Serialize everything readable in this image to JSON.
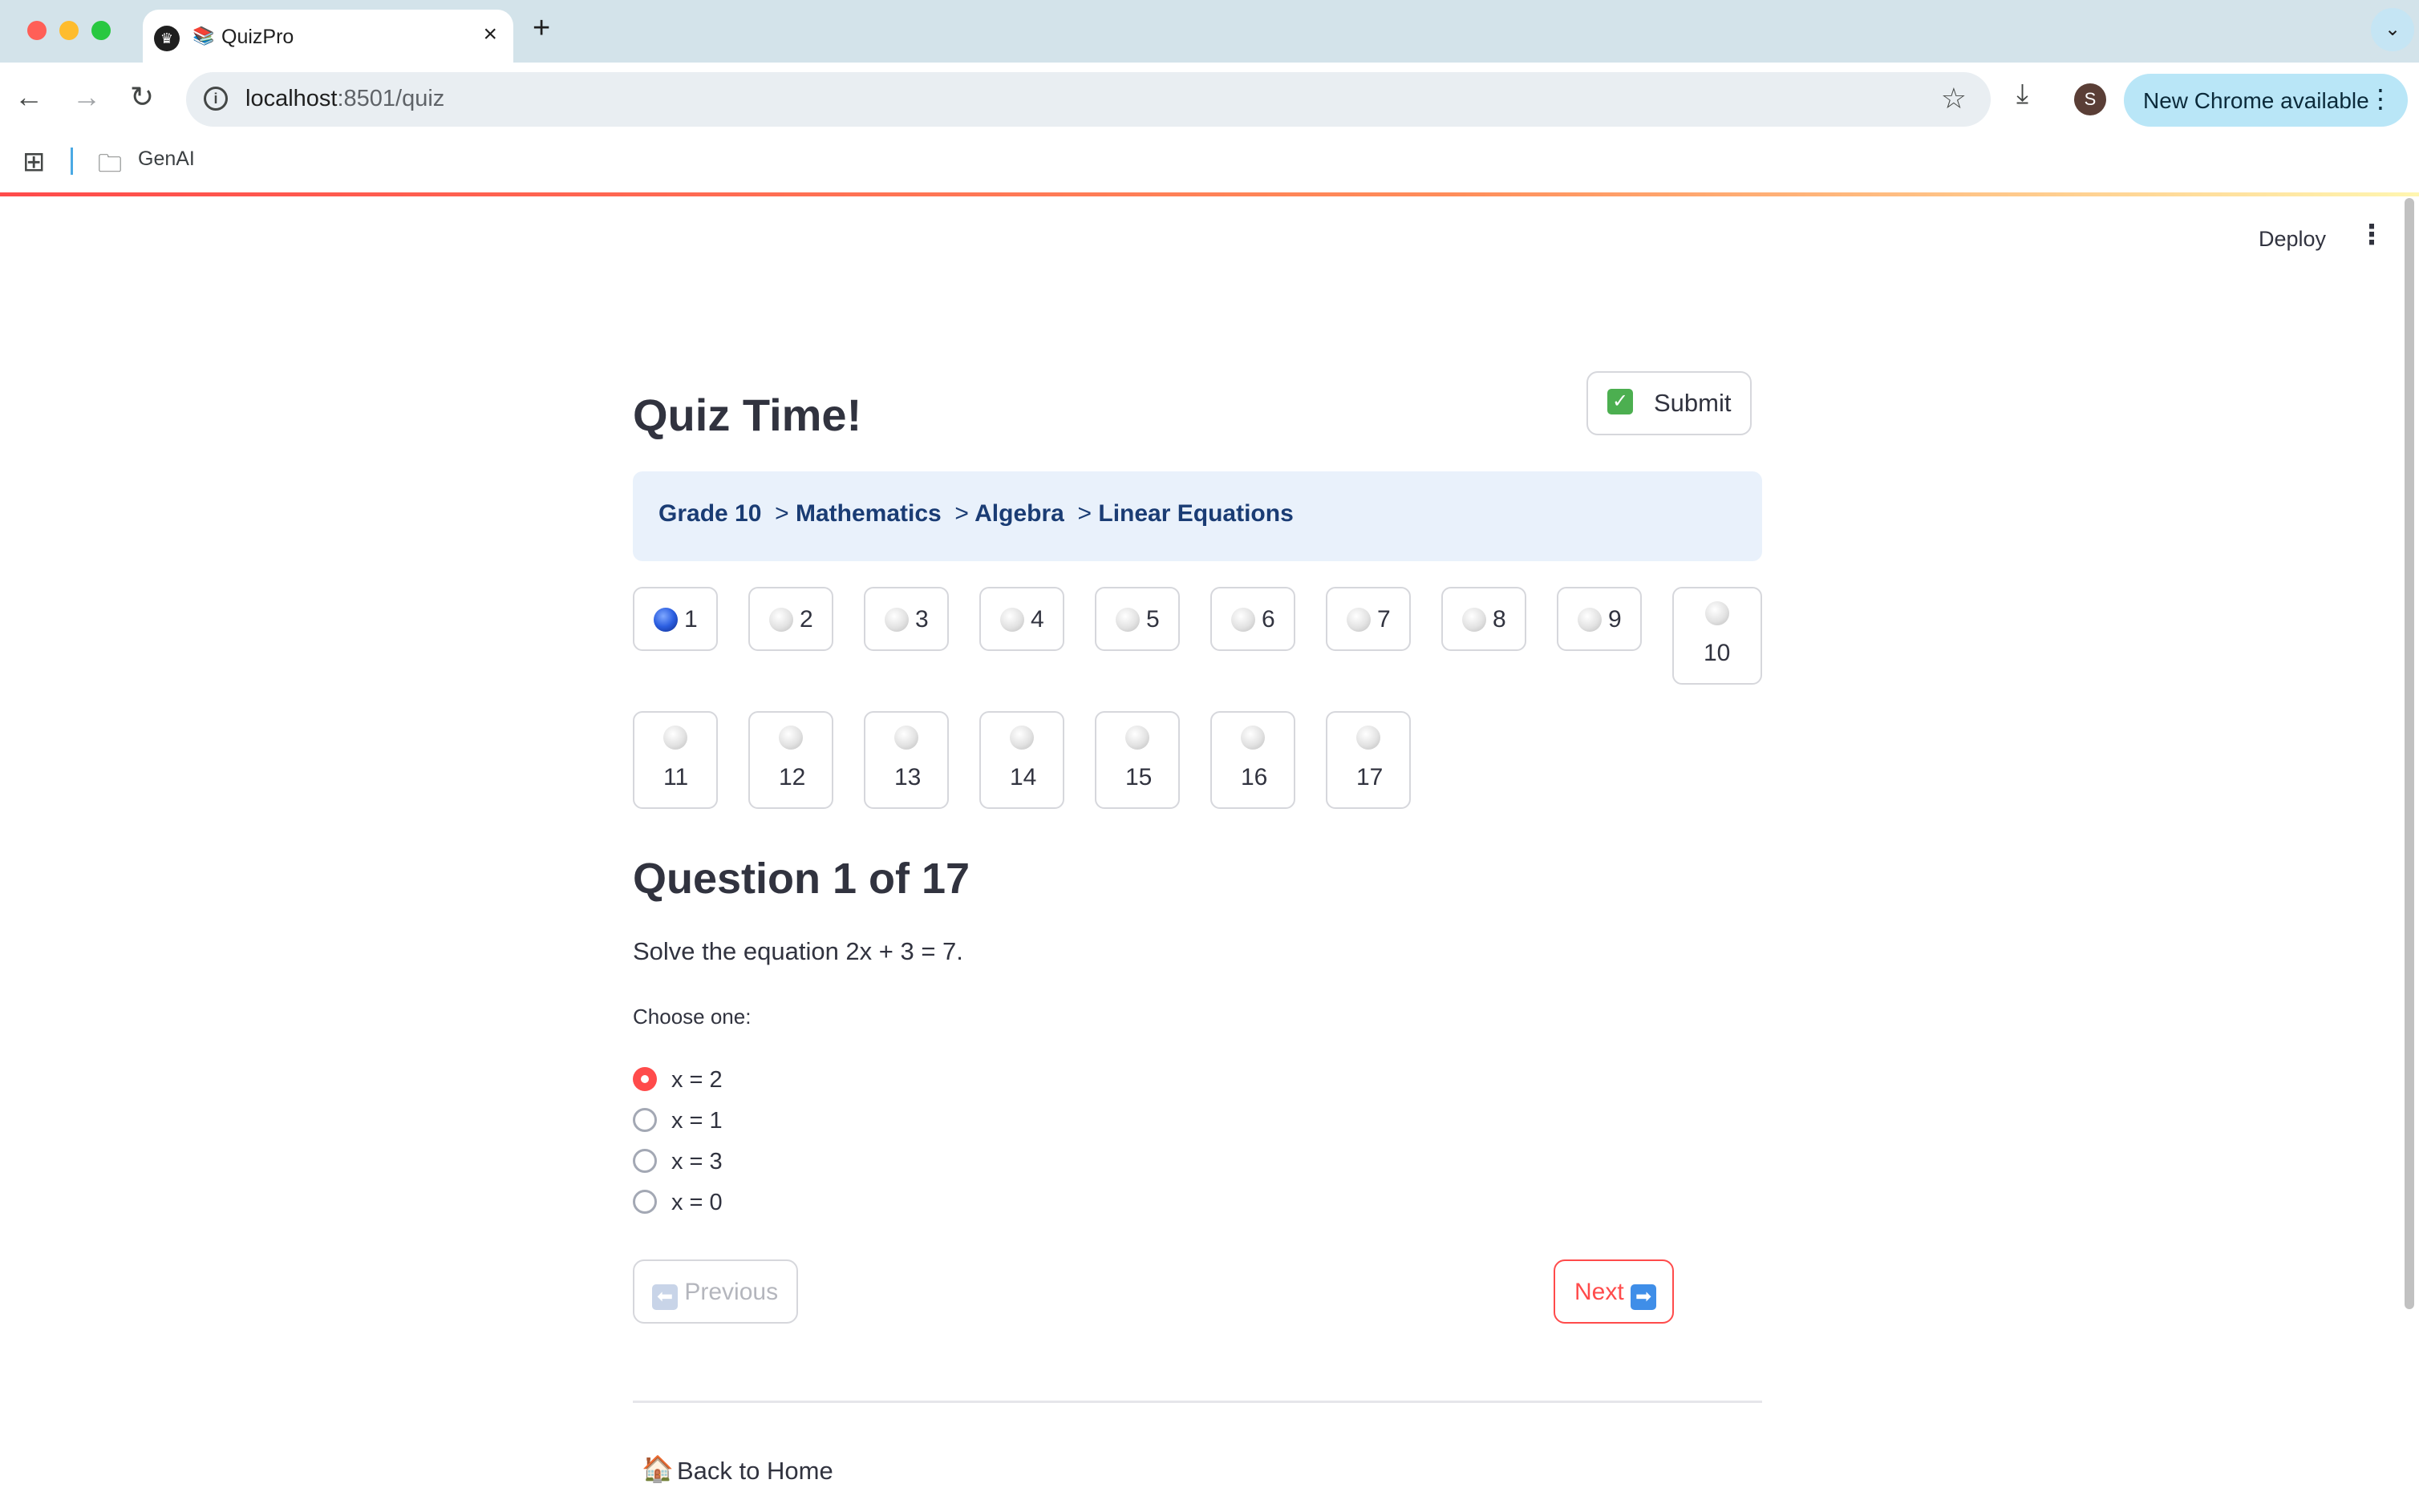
{
  "browser": {
    "tab_title": "QuizPro",
    "tab_emoji": "📚",
    "url_host": "localhost",
    "url_rest": ":8501/quiz",
    "update_label": "New Chrome available",
    "profile_initial": "S",
    "bookmark_folder": "GenAI"
  },
  "app_header": {
    "deploy_label": "Deploy"
  },
  "quiz": {
    "title": "Quiz Time!",
    "submit_label": "Submit",
    "breadcrumb": {
      "grade": "Grade 10",
      "subject": "Mathematics",
      "topic": "Algebra",
      "subtopic": "Linear Equations",
      "sep": ">"
    },
    "navigator": [
      {
        "number": "1",
        "active": true
      },
      {
        "number": "2"
      },
      {
        "number": "3"
      },
      {
        "number": "4"
      },
      {
        "number": "5"
      },
      {
        "number": "6"
      },
      {
        "number": "7"
      },
      {
        "number": "8"
      },
      {
        "number": "9"
      },
      {
        "number": "10"
      },
      {
        "number": "11"
      },
      {
        "number": "12"
      },
      {
        "number": "13"
      },
      {
        "number": "14"
      },
      {
        "number": "15"
      },
      {
        "number": "16"
      },
      {
        "number": "17"
      }
    ],
    "question_heading": "Question 1 of 17",
    "question_text": "Solve the equation 2x + 3 = 7.",
    "choose_label": "Choose one:",
    "options": [
      "x = 2",
      "x = 1",
      "x = 3",
      "x = 0"
    ],
    "selected_option": "x = 2",
    "previous_label": "Previous",
    "next_label": "Next",
    "back_home_label": "Back to Home"
  },
  "colors": {
    "accent": "#ff4b4b",
    "breadcrumb_bg": "#e9f1fb",
    "breadcrumb_text": "#1a3c74",
    "active_dot": "#2b5ee0"
  },
  "icons": {
    "submit": "check-box-icon",
    "previous": "left-arrow-icon",
    "next": "right-arrow-icon",
    "home": "house-icon"
  }
}
